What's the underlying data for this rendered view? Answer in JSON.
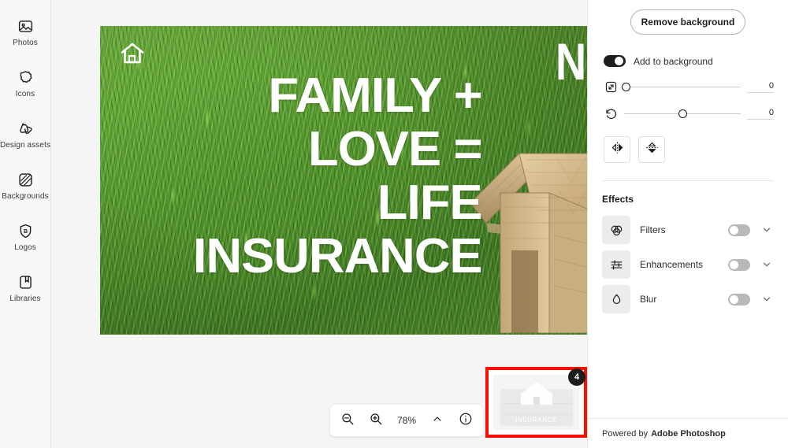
{
  "sidebar": {
    "items": [
      {
        "label": "Photos",
        "icon": "photos-icon"
      },
      {
        "label": "Icons",
        "icon": "icons-icon"
      },
      {
        "label": "Design assets",
        "icon": "design-assets-icon"
      },
      {
        "label": "Backgrounds",
        "icon": "backgrounds-icon"
      },
      {
        "label": "Logos",
        "icon": "logos-icon"
      },
      {
        "label": "Libraries",
        "icon": "libraries-icon"
      }
    ]
  },
  "canvas": {
    "info_icon": "info-icon",
    "image": {
      "headline_lines": [
        "FAMILY +",
        "LOVE =",
        "LIFE",
        "INSURANCE"
      ],
      "edge_letter": "N",
      "house_outline_icon": "house-outline-icon",
      "wooden_house_icon": "wooden-house-photo",
      "grass_color": "#4e9327",
      "text_color": "#ffffff"
    }
  },
  "zoom_bar": {
    "zoom_out_icon": "zoom-out-icon",
    "zoom_in_icon": "zoom-in-icon",
    "zoom_level": "78%",
    "chevron_up_icon": "chevron-up-icon",
    "info_icon": "info-icon"
  },
  "thumbnail": {
    "badge_count": "4",
    "label": "INSURANCE",
    "highlight_color": "#fa0f00"
  },
  "right_panel": {
    "remove_background_label": "Remove background",
    "add_to_background": {
      "label": "Add to background",
      "state": "on"
    },
    "sliders": [
      {
        "icon": "scale-icon",
        "value": "0",
        "handle_percent": 0
      },
      {
        "icon": "rotate-icon",
        "value": "0",
        "handle_percent": 50
      }
    ],
    "flip_buttons": [
      {
        "icon": "flip-horizontal-icon"
      },
      {
        "icon": "flip-vertical-icon"
      }
    ],
    "effects": {
      "title": "Effects",
      "rows": [
        {
          "label": "Filters",
          "icon": "filters-icon",
          "toggle": "off",
          "chevron": "chevron-down-icon"
        },
        {
          "label": "Enhancements",
          "icon": "enhancements-icon",
          "toggle": "off",
          "chevron": "chevron-down-icon"
        },
        {
          "label": "Blur",
          "icon": "blur-icon",
          "toggle": "off",
          "chevron": "chevron-down-icon"
        }
      ]
    },
    "footer": {
      "prefix": "Powered by",
      "brand": "Adobe Photoshop"
    }
  }
}
